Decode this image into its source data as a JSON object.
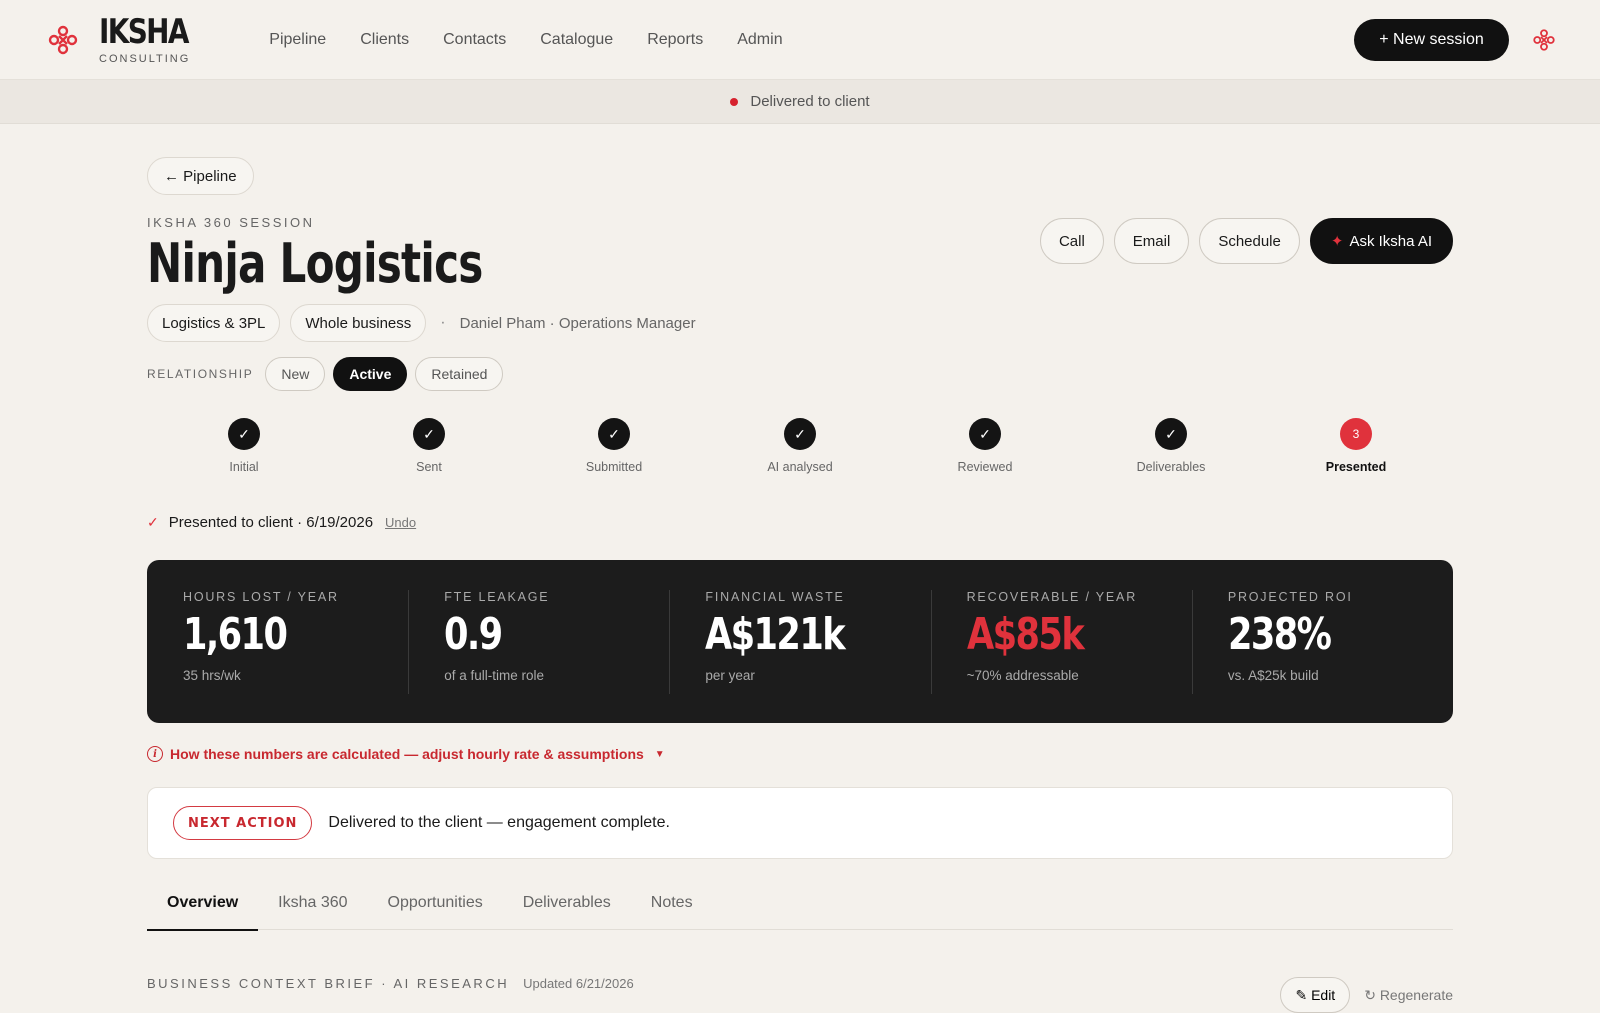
{
  "brand": {
    "name": "IKSHA",
    "sub": "CONSULTING"
  },
  "nav": [
    "Pipeline",
    "Clients",
    "Contacts",
    "Catalogue",
    "Reports",
    "Admin"
  ],
  "new_session": "+ New session",
  "banner": {
    "text": "Delivered to client"
  },
  "back": "← Pipeline",
  "session": {
    "eyebrow": "IKSHA 360 SESSION",
    "title": "Ninja Logistics",
    "tags": [
      "Logistics & 3PL",
      "Whole business"
    ],
    "person": "Daniel Pham · Operations Manager"
  },
  "actions": {
    "call": "Call",
    "email": "Email",
    "schedule": "Schedule",
    "ask_ai": "Ask Iksha AI"
  },
  "relationship": {
    "label": "RELATIONSHIP",
    "options": [
      "New",
      "Active",
      "Retained"
    ],
    "selected": "Active"
  },
  "steps": [
    {
      "label": "Initial",
      "mark": "✓"
    },
    {
      "label": "Sent",
      "mark": "✓"
    },
    {
      "label": "Submitted",
      "mark": "✓"
    },
    {
      "label": "AI analysed",
      "mark": "✓"
    },
    {
      "label": "Reviewed",
      "mark": "✓"
    },
    {
      "label": "Deliverables",
      "mark": "✓"
    },
    {
      "label": "Presented",
      "mark": "3"
    }
  ],
  "presented": {
    "text": "Presented to client · 6/19/2026",
    "undo": "Undo"
  },
  "metrics": [
    {
      "label": "HOURS LOST / YEAR",
      "value": "1,610",
      "sub": "35 hrs/wk"
    },
    {
      "label": "FTE LEAKAGE",
      "value": "0.9",
      "sub": "of a full-time role"
    },
    {
      "label": "FINANCIAL WASTE",
      "value": "A$121k",
      "sub": "per year"
    },
    {
      "label": "RECOVERABLE / YEAR",
      "value": "A$85k",
      "sub": "~70% addressable"
    },
    {
      "label": "PROJECTED ROI",
      "value": "238%",
      "sub": "vs. A$25k build"
    }
  ],
  "calc_link": "How these numbers are calculated — adjust hourly rate & assumptions",
  "next_action": {
    "badge": "NEXT ACTION",
    "text": "Delivered to the client — engagement complete."
  },
  "tabs": [
    "Overview",
    "Iksha 360",
    "Opportunities",
    "Deliverables",
    "Notes"
  ],
  "brief": {
    "label": "BUSINESS CONTEXT BRIEF · AI RESEARCH",
    "updated": "Updated 6/21/2026",
    "edit": "✎ Edit",
    "regenerate": "↻ Regenerate"
  },
  "colors": {
    "accent": "#e0323c",
    "dark": "#1c1c1c",
    "background": "#f4f1ec"
  }
}
